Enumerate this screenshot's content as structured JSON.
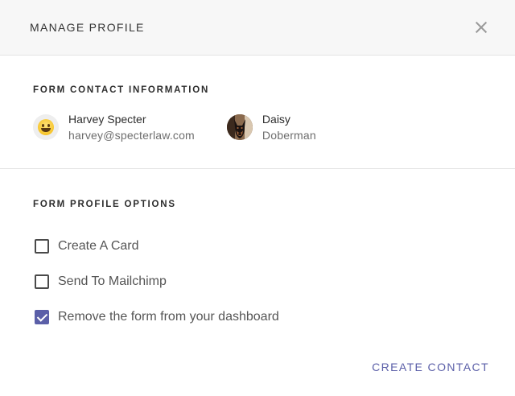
{
  "header": {
    "title": "MANAGE PROFILE"
  },
  "contact_section": {
    "title": "FORM CONTACT INFORMATION",
    "contacts": [
      {
        "name": "Harvey Specter",
        "sub": "harvey@specterlaw.com",
        "avatar": "grinning-emoji-avatar"
      },
      {
        "name": "Daisy",
        "sub": "Doberman",
        "avatar": "dog-photo-avatar"
      }
    ]
  },
  "options_section": {
    "title": "FORM PROFILE OPTIONS",
    "options": [
      {
        "label": "Create A Card",
        "checked": false
      },
      {
        "label": "Send To Mailchimp",
        "checked": false
      },
      {
        "label": "Remove the form from your dashboard",
        "checked": true
      }
    ]
  },
  "footer": {
    "create_label": "CREATE CONTACT"
  },
  "colors": {
    "accent": "#5b5fa8",
    "header_bg": "#f7f7f7",
    "divider": "#e4e4e4"
  }
}
